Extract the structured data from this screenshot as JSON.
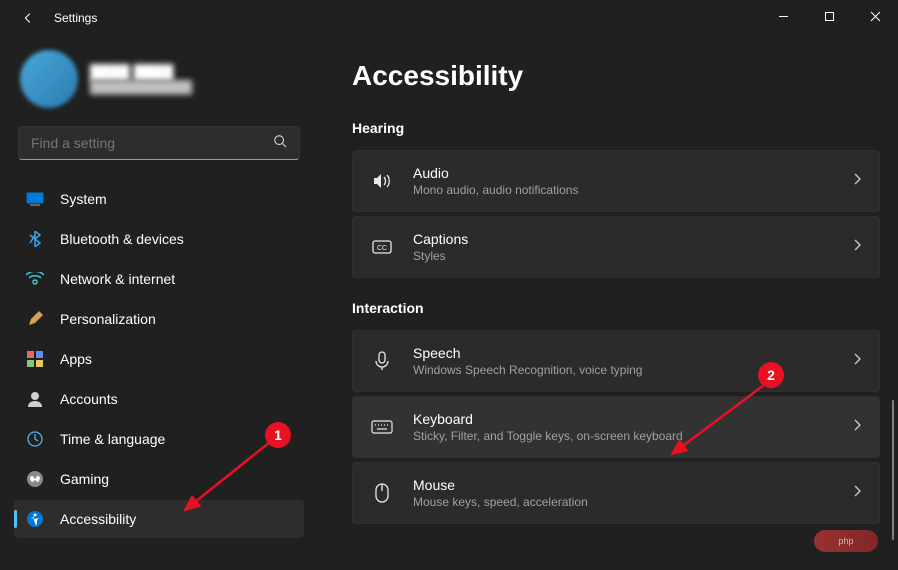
{
  "window": {
    "title": "Settings"
  },
  "profile": {
    "name": "████ ████",
    "email": "████████████"
  },
  "search": {
    "placeholder": "Find a setting"
  },
  "sidebar": {
    "items": [
      {
        "label": "System"
      },
      {
        "label": "Bluetooth & devices"
      },
      {
        "label": "Network & internet"
      },
      {
        "label": "Personalization"
      },
      {
        "label": "Apps"
      },
      {
        "label": "Accounts"
      },
      {
        "label": "Time & language"
      },
      {
        "label": "Gaming"
      },
      {
        "label": "Accessibility",
        "active": true
      }
    ]
  },
  "page": {
    "title": "Accessibility",
    "sections": [
      {
        "label": "Hearing",
        "items": [
          {
            "title": "Audio",
            "sub": "Mono audio, audio notifications"
          },
          {
            "title": "Captions",
            "sub": "Styles"
          }
        ]
      },
      {
        "label": "Interaction",
        "items": [
          {
            "title": "Speech",
            "sub": "Windows Speech Recognition, voice typing"
          },
          {
            "title": "Keyboard",
            "sub": "Sticky, Filter, and Toggle keys, on-screen keyboard",
            "highlight": true
          },
          {
            "title": "Mouse",
            "sub": "Mouse keys, speed, acceleration"
          }
        ]
      }
    ]
  },
  "annotations": {
    "badge1": "1",
    "badge2": "2"
  },
  "watermark": "php"
}
